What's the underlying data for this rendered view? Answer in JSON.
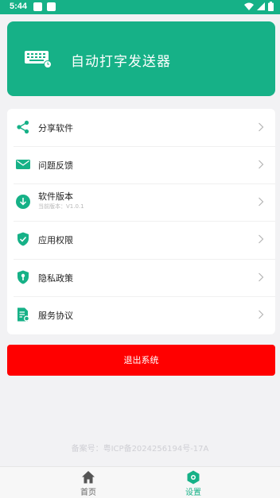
{
  "status_bar": {
    "time": "5:44"
  },
  "header": {
    "app_title": "自动打字发送器",
    "icon": "keyboard-icon"
  },
  "menu": [
    {
      "label": "分享软件",
      "icon": "share-icon"
    },
    {
      "label": "问题反馈",
      "icon": "mail-icon"
    },
    {
      "label": "软件版本",
      "sub": "当前版本：V1.0.1",
      "icon": "download-icon"
    },
    {
      "label": "应用权限",
      "icon": "shield-check-icon"
    },
    {
      "label": "隐私政策",
      "icon": "shield-key-icon"
    },
    {
      "label": "服务协议",
      "icon": "document-icon"
    }
  ],
  "logout_label": "退出系统",
  "icp_text": "备案号：粤ICP备2024256194号-17A",
  "tabbar": {
    "home_label": "首页",
    "settings_label": "设置",
    "active": "settings"
  },
  "colors": {
    "brand": "#16b187",
    "danger": "#ff0000"
  }
}
